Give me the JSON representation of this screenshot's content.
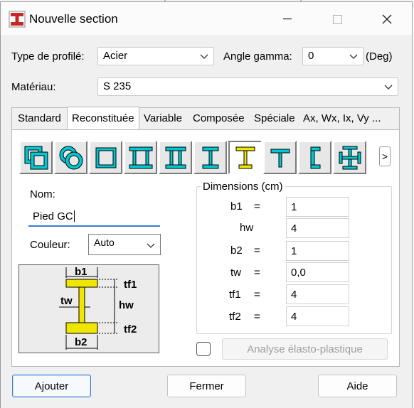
{
  "window": {
    "title": "Nouvelle section"
  },
  "form": {
    "profile_type_label": "Type de profilé:",
    "profile_type_value": "Acier",
    "angle_label": "Angle gamma:",
    "angle_value": "0",
    "angle_unit": "(Deg)",
    "material_label": "Matériau:",
    "material_value": "S 235"
  },
  "tabs": [
    "Standard",
    "Reconstituée",
    "Variable",
    "Composée",
    "Spéciale",
    "Ax, Wx, Ix, Vy ..."
  ],
  "shapes": {
    "more_label": ">",
    "items": [
      "box-tube",
      "circle-tube",
      "rect-hollow",
      "double-channel-box",
      "channel-box",
      "i-beam",
      "i-beam-asymmetric",
      "t-section",
      "c-channel",
      "cruciform"
    ]
  },
  "name": {
    "label": "Nom:",
    "value": "Pied GC"
  },
  "color": {
    "label": "Couleur:",
    "value": "Auto"
  },
  "dimensions": {
    "title": "Dimensions (cm)",
    "rows": [
      {
        "label": "b1",
        "eq": "=",
        "value": "1"
      },
      {
        "label": "hw",
        "eq": "",
        "value": "4"
      },
      {
        "label": "b2",
        "eq": "=",
        "value": "1"
      },
      {
        "label": "tw",
        "eq": "=",
        "value": "0,0"
      },
      {
        "label": "tf1",
        "eq": "=",
        "value": "4"
      },
      {
        "label": "tf2",
        "eq": "=",
        "value": "4"
      }
    ]
  },
  "diagram": {
    "b1": "b1",
    "tf1": "tf1",
    "tw": "tw",
    "hw": "hw",
    "tf2": "tf2",
    "b2": "b2"
  },
  "analysis": {
    "label": "Analyse élasto-plastique",
    "checked": false
  },
  "buttons": {
    "add": "Ajouter",
    "close": "Fermer",
    "help": "Aide"
  },
  "colors": {
    "accent": "#3a7bd5",
    "shape_fill": "#00c8d2",
    "ibeam_fill": "#f0e600",
    "icon_red": "#c62828"
  }
}
